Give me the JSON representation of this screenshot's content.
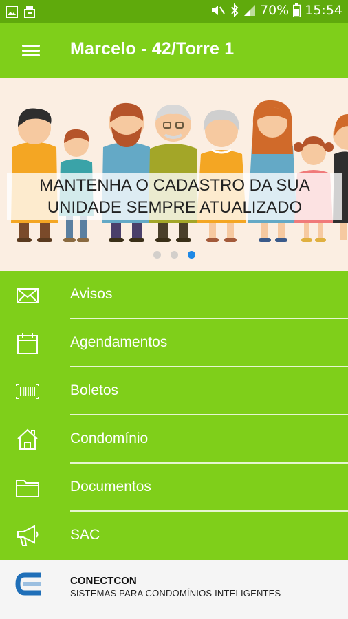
{
  "status_bar": {
    "battery_percent": "70%",
    "time": "15:54"
  },
  "app_bar": {
    "title": "Marcelo - 42/Torre 1"
  },
  "banner": {
    "caption_line1": "MANTENHA O CADASTRO DA SUA",
    "caption_line2": "UNIDADE SEMPRE ATUALIZADO",
    "slide_count": 3,
    "active_slide": 3
  },
  "menu": {
    "items": [
      {
        "label": "Avisos",
        "icon": "envelope-icon"
      },
      {
        "label": "Agendamentos",
        "icon": "calendar-icon"
      },
      {
        "label": "Boletos",
        "icon": "barcode-icon"
      },
      {
        "label": "Condomínio",
        "icon": "house-icon"
      },
      {
        "label": "Documentos",
        "icon": "folder-icon"
      },
      {
        "label": "SAC",
        "icon": "megaphone-icon"
      }
    ]
  },
  "footer": {
    "brand": "CONECTCON",
    "tagline": "SISTEMAS PARA CONDOMÍNIOS INTELIGENTES"
  },
  "colors": {
    "primary": "#7fcf1a",
    "status_bar": "#5faa0c",
    "banner_bg": "#fbeee2",
    "dot_active": "#1e88e5",
    "logo_blue": "#1f6fb8"
  }
}
